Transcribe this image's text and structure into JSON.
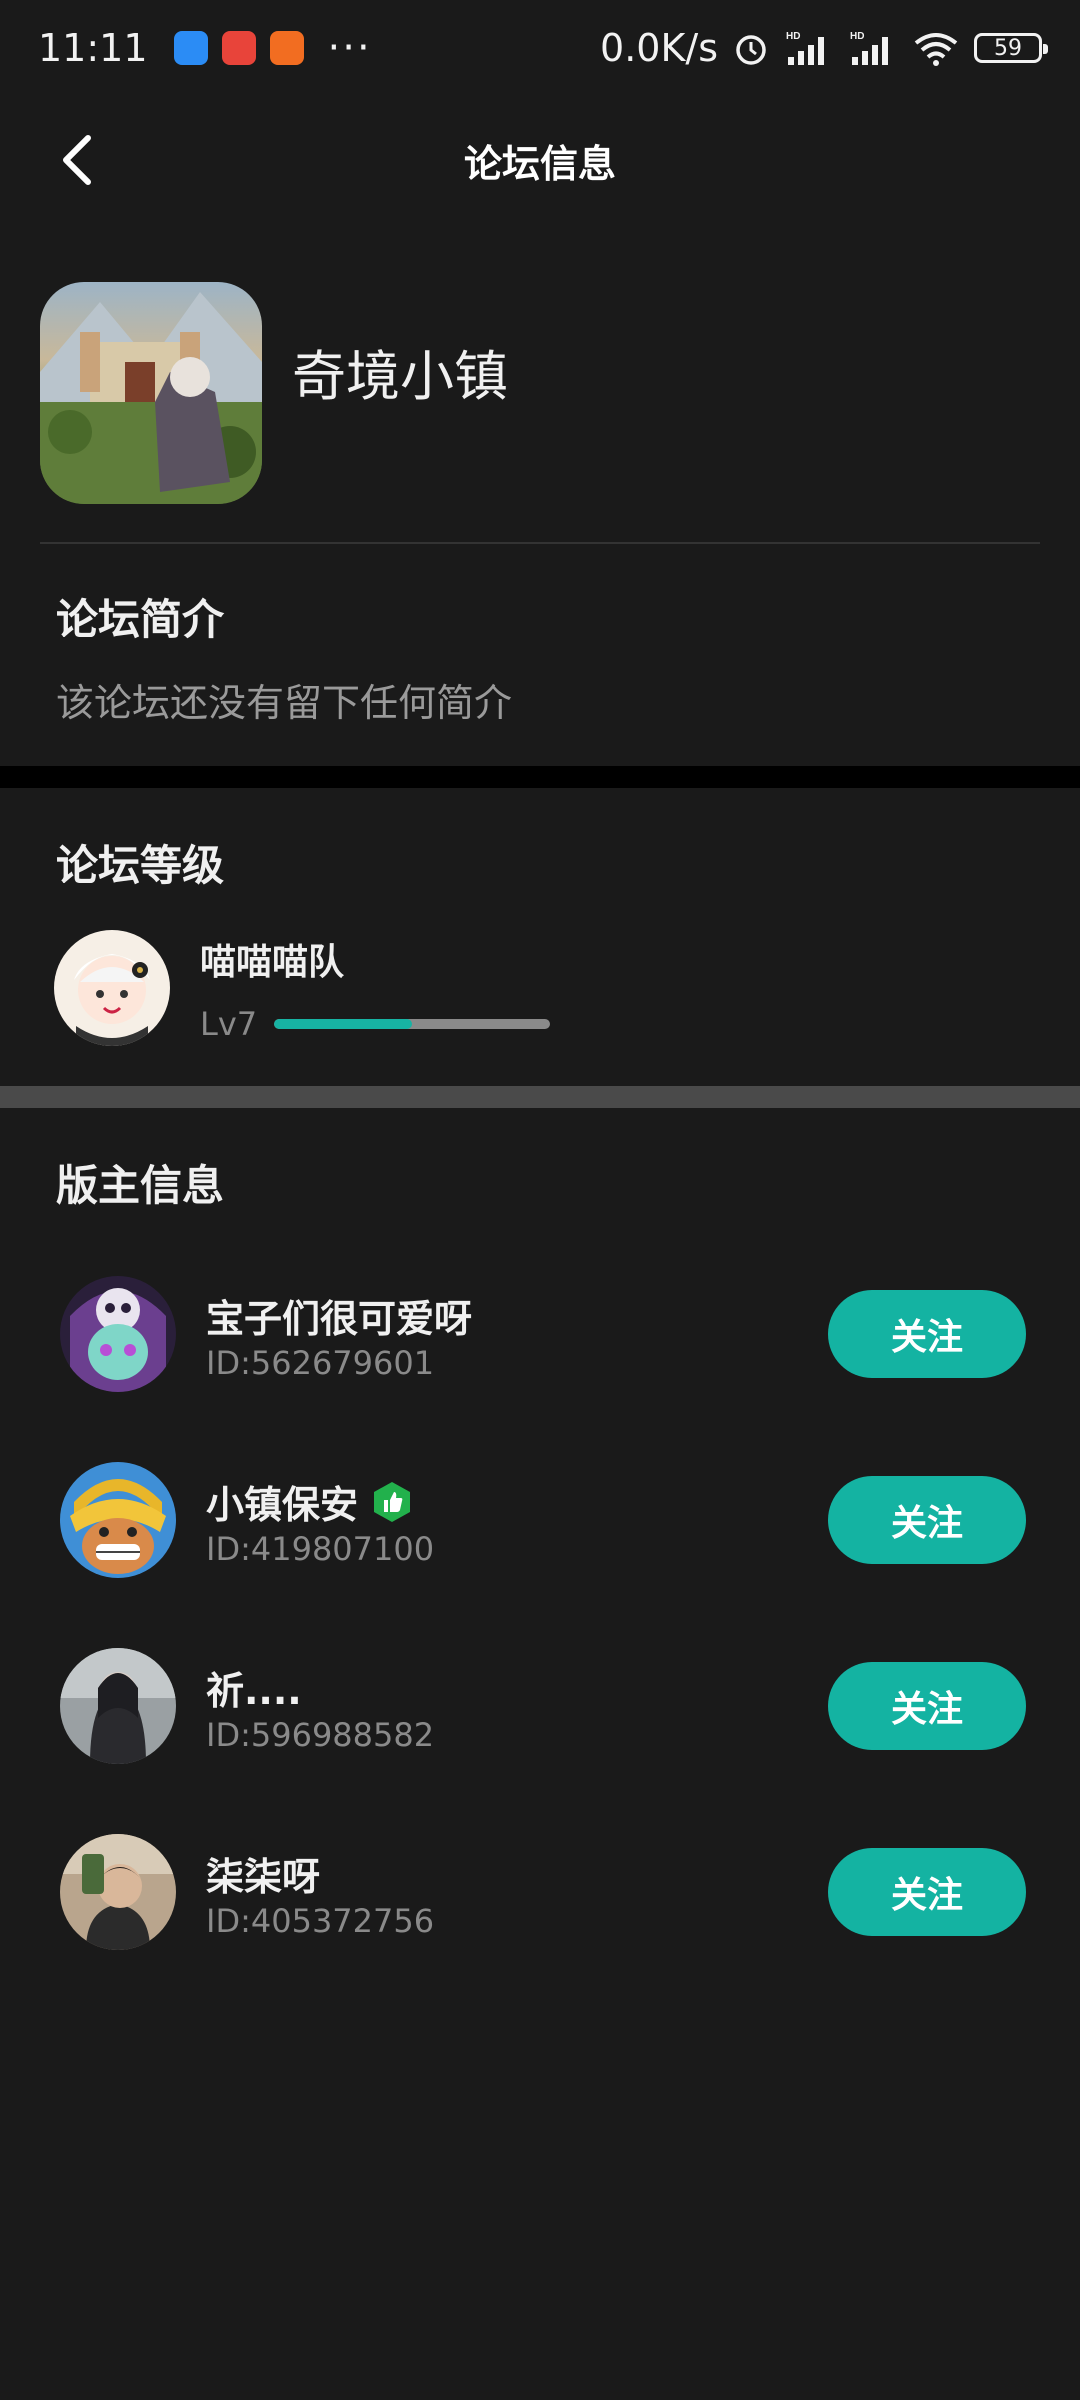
{
  "status_bar": {
    "time": "11:11",
    "network_speed": "0.0K/s",
    "battery": "59",
    "icons": [
      "app-icon-blue",
      "app-icon-red",
      "mi-icon",
      "more-dots",
      "alarm-icon",
      "signal-hd-icon",
      "signal-hd-icon",
      "wifi-icon",
      "battery-icon"
    ]
  },
  "header": {
    "title": "论坛信息",
    "back_icon": "chevron-left-icon"
  },
  "forum": {
    "name": "奇境小镇",
    "intro_title": "论坛简介",
    "intro_text": "该论坛还没有留下任何简介"
  },
  "level": {
    "title": "论坛等级",
    "team_name": "喵喵喵队",
    "level_label": "Lv7",
    "progress": 0.5,
    "progress_color": "#17b3a3"
  },
  "moderators": {
    "title": "版主信息",
    "follow_label": "关注",
    "items": [
      {
        "name": "宝子们很可爱呀",
        "id": "ID:562679601",
        "badge": ""
      },
      {
        "name": "小镇保安",
        "id": "ID:419807100",
        "badge": "thumbs-up-badge-icon"
      },
      {
        "name": "祈....",
        "id": "ID:596988582",
        "badge": ""
      },
      {
        "name": "柒柒呀",
        "id": "ID:405372756",
        "badge": ""
      }
    ]
  },
  "colors": {
    "background": "#1a1a1a",
    "accent": "#14b3a2",
    "badge_green": "#22b14c"
  }
}
